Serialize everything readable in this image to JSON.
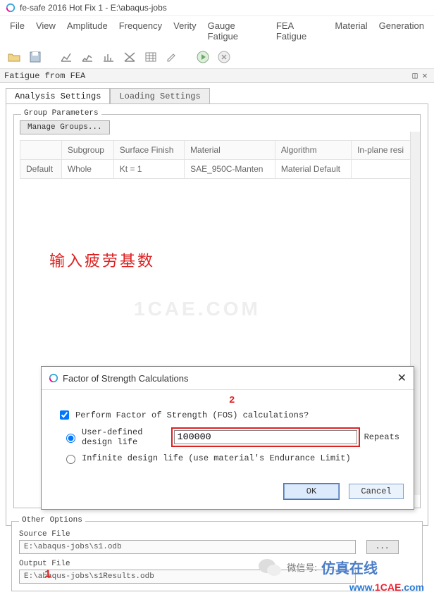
{
  "window": {
    "title": "fe-safe 2016 Hot Fix 1 - E:\\abaqus-jobs"
  },
  "menu": [
    "File",
    "View",
    "Amplitude",
    "Frequency",
    "Verity",
    "Gauge Fatigue",
    "FEA Fatigue",
    "Material",
    "Generation"
  ],
  "dock": {
    "title": "Fatigue from FEA",
    "pin_glyph": "◫",
    "close_glyph": "✕"
  },
  "tabs": {
    "analysis": "Analysis Settings",
    "loading": "Loading Settings"
  },
  "group": {
    "title": "Group Parameters",
    "manage": "Manage Groups...",
    "columns": [
      "",
      "Subgroup",
      "Surface Finish",
      "Material",
      "Algorithm",
      "In-plane resi"
    ],
    "row": {
      "hdr": "Default",
      "cells": [
        "Whole",
        "Kt = 1",
        "SAE_950C-Manten",
        "Material Default",
        ""
      ]
    }
  },
  "annotation": {
    "red_text": "输入疲劳基数",
    "red_num_2": "2",
    "red_num_1": "1"
  },
  "watermark": "1CAE.COM",
  "dialog": {
    "title": "Factor of Strength Calculations",
    "perform_label": "Perform Factor of Strength (FOS) calculations?",
    "perform_checked": true,
    "radio_user_label": "User-defined design life",
    "radio_user_selected": true,
    "design_life_value": "100000",
    "repeats_label": "Repeats",
    "radio_inf_label": "Infinite design life (use material's Endurance Limit)",
    "ok": "OK",
    "cancel": "Cancel"
  },
  "other": {
    "title": "Other Options",
    "source_label": "Source File",
    "source_value": "E:\\abaqus-jobs\\s1.odb",
    "output_label": "Output File",
    "output_value": "E:\\abaqus-jobs\\s1Results.odb",
    "browse": "..."
  },
  "footer": {
    "wechat_label": "微信号:",
    "wechat_cn": "仿真在线",
    "brand_prefix": "www.",
    "brand_main": "1CAE",
    "brand_suffix": ".com"
  }
}
